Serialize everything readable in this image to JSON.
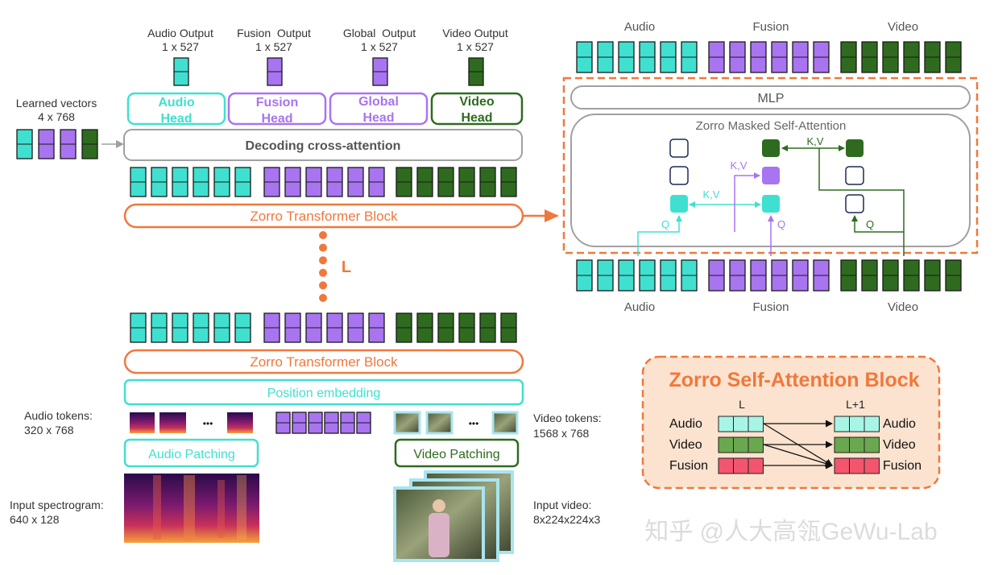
{
  "colors": {
    "audio": "#40e0d0",
    "fusion": "#a874f0",
    "video": "#2e6b1f",
    "orange": "#f0783c",
    "gray": "#a0a0a0",
    "token_stroke": "#1a1a1a",
    "block_fill": "#fbe3cf"
  },
  "outputs": {
    "audio": {
      "title": "Audio Output",
      "dims": "1 x 527"
    },
    "fusion": {
      "title": "Fusion  Output",
      "dims": "1 x 527"
    },
    "global": {
      "title": "Global  Output",
      "dims": "1 x 527"
    },
    "video": {
      "title": "Video Output",
      "dims": "1 x 527"
    }
  },
  "heads": {
    "audio": [
      "Audio",
      "Head"
    ],
    "fusion": [
      "Fusion",
      "Head"
    ],
    "global": [
      "Global",
      "Head"
    ],
    "video": [
      "Video",
      "Head"
    ]
  },
  "learned_vectors": {
    "title": "Learned vectors",
    "dims": "4 x 768"
  },
  "decoding_label": "Decoding cross-attention",
  "transformer_block": "Zorro Transformer Block",
  "layer_symbol": "L",
  "position_embedding": "Position embedding",
  "audio_tokens": {
    "title": "Audio tokens:",
    "dims": "320 x 768"
  },
  "video_tokens": {
    "title": "Video tokens:",
    "dims": "1568 x 768"
  },
  "ellipsis": "•••",
  "audio_patching": "Audio Patching",
  "video_patching": "Video Patching",
  "input_spectrogram": {
    "title": "Input spectrogram:",
    "dims": "640 x 128"
  },
  "input_video": {
    "title": "Input video:",
    "dims": "8x224x224x3"
  },
  "detail": {
    "top_labels": {
      "audio": "Audio",
      "fusion": "Fusion",
      "video": "Video"
    },
    "bottom_labels": {
      "audio": "Audio",
      "fusion": "Fusion",
      "video": "Video"
    },
    "mlp": "MLP",
    "masked_attention": "Zorro Masked Self-Attention",
    "kv": "K,V",
    "q": "Q"
  },
  "block_panel": {
    "title": "Zorro Self-Attention Block",
    "layer_in": "L",
    "layer_out": "L+1",
    "rows": [
      {
        "name": "Audio",
        "color": "#a8f5e6"
      },
      {
        "name": "Video",
        "color": "#6aa84f"
      },
      {
        "name": "Fusion",
        "color": "#f4556e"
      }
    ]
  },
  "watermark": "知乎 @人大高瓴GeWu-Lab"
}
